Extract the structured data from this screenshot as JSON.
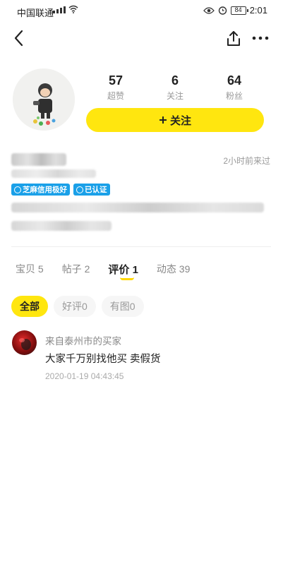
{
  "status_bar": {
    "carrier": "中国联通",
    "time": "2:01",
    "battery": "84"
  },
  "profile": {
    "stats": [
      {
        "value": "57",
        "label": "超赞"
      },
      {
        "value": "6",
        "label": "关注"
      },
      {
        "value": "64",
        "label": "粉丝"
      }
    ],
    "follow_label": "关注",
    "last_seen": "2小时前来过",
    "badges": [
      "芝麻信用极好",
      "已认证"
    ]
  },
  "tabs": [
    {
      "label": "宝贝",
      "count": "5"
    },
    {
      "label": "帖子",
      "count": "2"
    },
    {
      "label": "评价",
      "count": "1"
    },
    {
      "label": "动态",
      "count": "39"
    }
  ],
  "filters": [
    "全部",
    "好评0",
    "有图0"
  ],
  "review": {
    "reviewer": "来自泰州市的买家",
    "text": "大家千万别找他买 卖假货",
    "time": "2020-01-19 04:43:45"
  }
}
